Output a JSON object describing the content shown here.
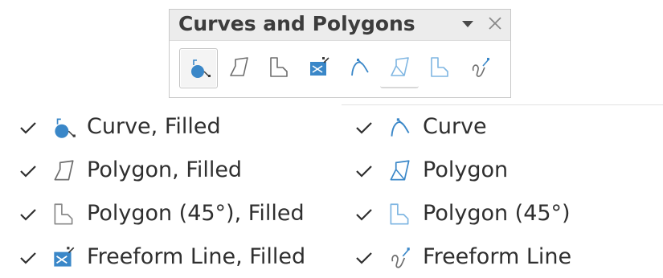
{
  "panel": {
    "title": "Curves and Polygons",
    "menu_icon": "triangle-down-icon",
    "close_icon": "close-icon",
    "tools": [
      {
        "name": "curve-filled",
        "icon": "curve-filled-icon"
      },
      {
        "name": "polygon-filled",
        "icon": "polygon-filled-icon"
      },
      {
        "name": "polygon-45-filled",
        "icon": "polygon-45-filled-icon"
      },
      {
        "name": "freeform-line-filled",
        "icon": "freeform-line-filled-icon"
      },
      {
        "name": "curve",
        "icon": "curve-icon"
      },
      {
        "name": "polygon",
        "icon": "polygon-icon"
      },
      {
        "name": "polygon-45",
        "icon": "polygon-45-icon"
      },
      {
        "name": "freeform-line",
        "icon": "freeform-line-icon"
      }
    ]
  },
  "commands": [
    {
      "label": "Curve, Filled",
      "checked": true,
      "icon": "curve-filled-icon"
    },
    {
      "label": "Polygon, Filled",
      "checked": true,
      "icon": "polygon-filled-icon"
    },
    {
      "label": "Polygon (45°), Filled",
      "checked": true,
      "icon": "polygon-45-filled-icon"
    },
    {
      "label": "Freeform Line, Filled",
      "checked": true,
      "icon": "freeform-line-filled-icon"
    },
    {
      "label": "Curve",
      "checked": true,
      "icon": "curve-icon"
    },
    {
      "label": "Polygon",
      "checked": true,
      "icon": "polygon-icon"
    },
    {
      "label": "Polygon (45°)",
      "checked": true,
      "icon": "polygon-45-icon"
    },
    {
      "label": "Freeform Line",
      "checked": true,
      "icon": "freeform-line-icon"
    }
  ],
  "colors": {
    "accent_blue": "#3a87c8",
    "light_blue": "#7fb6e2",
    "icon_gray": "#6e6e6e",
    "text": "#2f2f2f"
  }
}
